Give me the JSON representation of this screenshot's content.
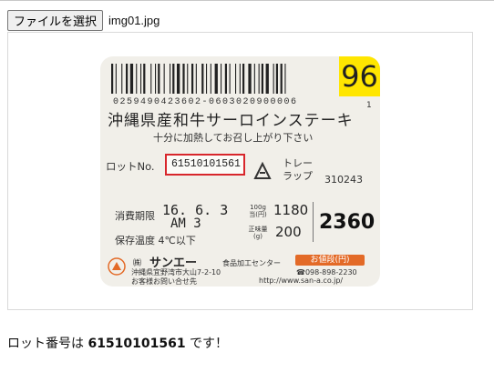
{
  "file_input": {
    "button_label": "ファイルを選択",
    "file_name": "img01.jpg"
  },
  "label_image": {
    "price_badge": "96",
    "barcode_number": "0259490423602-0603020900006",
    "barcode_sub": "1",
    "product_name": "沖縄県産和牛サーロインステーキ",
    "cooking_note": "十分に加熱してお召し上がり下さい",
    "lot_label": "ロットNo.",
    "lot_value": "61510101561",
    "tray_text": "トレー",
    "wrap_text": "ラップ",
    "code2": "310243",
    "expiry_label": "消費期限",
    "expiry_date": "16. 6. 3",
    "expiry_ampm": "AM 3",
    "storage": "保存温度 4℃以下",
    "unit_price_label": "100g当(円)",
    "unit_price": "1180",
    "weight_label": "正味量(g)",
    "weight": "200",
    "total": "2360",
    "company_sym": "㈱",
    "company": "サンエー",
    "center": "食品加工センター",
    "price_tag": "お値段(円)",
    "address": "沖縄県宜野湾市大山7-2-10",
    "phone": "☎098-898-2230",
    "inquiry": "お客様お問い合せ先",
    "url": "http://www.san-a.co.jp/"
  },
  "result": {
    "prefix": "ロット番号は ",
    "lot": "61510101561",
    "suffix": " です！"
  },
  "colors": {
    "lot_box": "#d8262c",
    "badge": "#ffe600",
    "price_tag": "#e36a27"
  }
}
